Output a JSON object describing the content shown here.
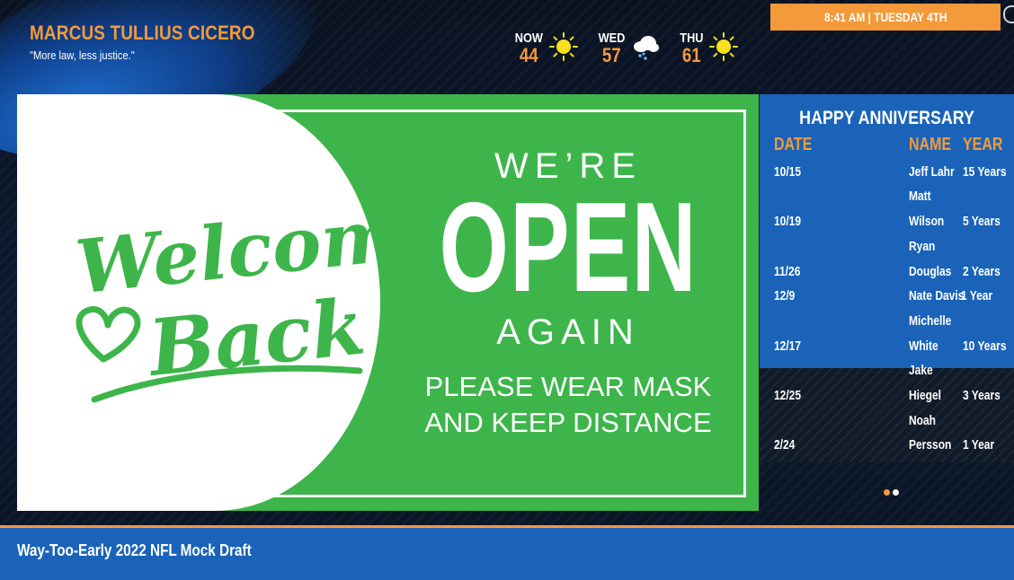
{
  "header": {
    "name": "MARCUS TULLIUS CICERO",
    "quote": "\"More law, less justice.\""
  },
  "weather": [
    {
      "day": "NOW",
      "temp": "44",
      "icon": "sun-icon"
    },
    {
      "day": "WED",
      "temp": "57",
      "icon": "cloud-rain-icon"
    },
    {
      "day": "THU",
      "temp": "61",
      "icon": "sun-icon"
    }
  ],
  "clock": "8:41 AM | TUESDAY 4TH",
  "poster": {
    "welcome_line1": "Welcome",
    "welcome_line2": "Back",
    "were": "WE’RE",
    "open": "OPEN",
    "again": "AGAIN",
    "mask_line1": "PLEASE WEAR MASK",
    "mask_line2": "AND KEEP DISTANCE"
  },
  "anniversary": {
    "title": "HAPPY ANNIVERSARY",
    "col_date": "DATE",
    "col_name": "NAME",
    "col_year": "YEAR",
    "rows": [
      {
        "date": "10/15",
        "name1": "Jeff Lahr",
        "name2": "",
        "year": "15 Years"
      },
      {
        "date": "10/19",
        "name1": "Matt",
        "name2": "Wilson",
        "year": "5 Years"
      },
      {
        "date": "11/26",
        "name1": "Ryan",
        "name2": "Douglas",
        "year": "2 Years"
      },
      {
        "date": "12/9",
        "name1": "Nate Davis",
        "name2": "",
        "year": "1 Year"
      },
      {
        "date": "12/17",
        "name1": "Michelle",
        "name2": "White",
        "year": "10 Years"
      },
      {
        "date": "12/25",
        "name1": "Jake",
        "name2": "Hiegel",
        "year": "3 Years"
      },
      {
        "date": "2/24",
        "name1": "Noah",
        "name2": "Persson",
        "year": "1 Year"
      }
    ]
  },
  "colors": {
    "accent": "#f49a3a",
    "brand_blue": "#1a63b8",
    "poster_green": "#3db54a",
    "dot_active": "#f49a3a",
    "dot_inactive": "#ffffff"
  },
  "ticker": "Way-Too-Early 2022 NFL Mock Draft"
}
